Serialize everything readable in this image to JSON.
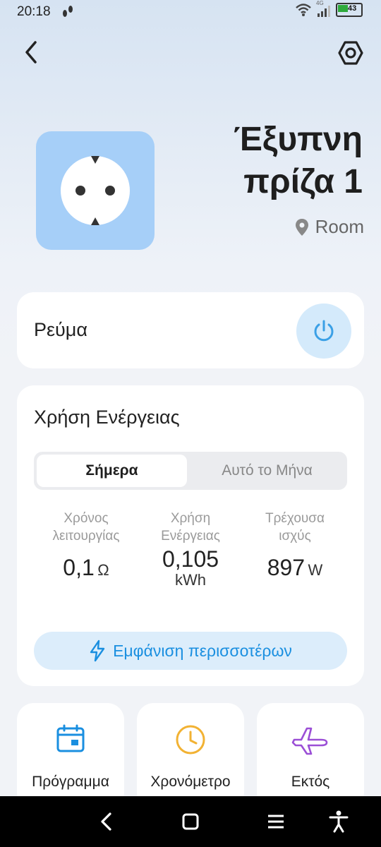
{
  "status_bar": {
    "time": "20:18",
    "battery": "43",
    "network": "4G"
  },
  "header": {
    "back_icon": "back-arrow-icon",
    "settings_icon": "settings-hexagon-icon"
  },
  "device": {
    "title_line1": "Έξυπνη",
    "title_line2": "πρίζα 1",
    "room": "Room",
    "tile_color": "#a6cff8"
  },
  "power": {
    "label": "Ρεύμα",
    "accent": "#3ba0e6"
  },
  "energy": {
    "title": "Χρήση Ενέργειας",
    "tabs": [
      {
        "label": "Σήμερα",
        "selected": true
      },
      {
        "label": "Αυτό το Μήνα",
        "selected": false
      }
    ],
    "stats": [
      {
        "label_line1": "Χρόνος",
        "label_line2": "λειτουργίας",
        "value": "0,1",
        "unit": "Ω"
      },
      {
        "label_line1": "Χρήση",
        "label_line2": "Ενέργειας",
        "value": "0,105",
        "unit": "kWh"
      },
      {
        "label_line1": "Τρέχουσα",
        "label_line2": "ισχύς",
        "value": "897",
        "unit": "W"
      }
    ],
    "show_more": "Εμφάνιση περισσοτέρων"
  },
  "tiles": [
    {
      "label": "Πρόγραμμα",
      "icon": "calendar-icon",
      "color": "#1a8fe0"
    },
    {
      "label": "Χρονόμετρο",
      "icon": "clock-icon",
      "color": "#f2b233"
    },
    {
      "label": "Εκτός",
      "icon": "airplane-icon",
      "color": "#9b4fd6"
    }
  ],
  "nav_bar": [
    "back-icon",
    "home-icon",
    "menu-icon",
    "accessibility-icon"
  ]
}
